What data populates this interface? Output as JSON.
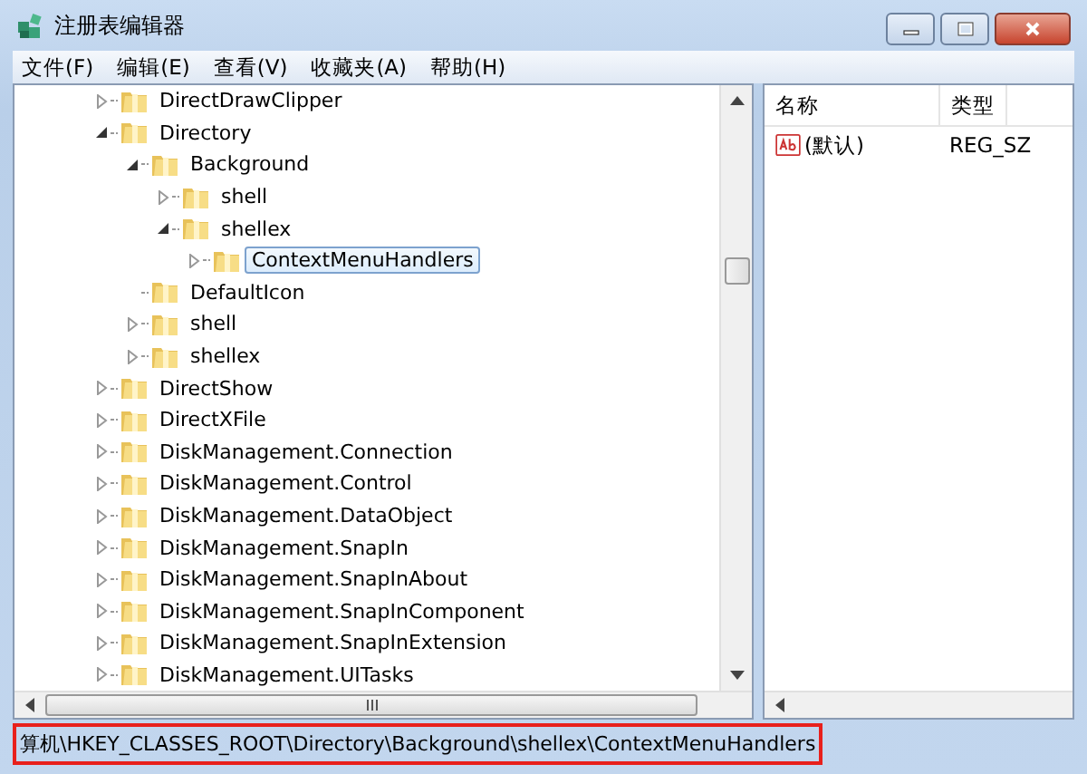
{
  "window": {
    "title": "注册表编辑器"
  },
  "menu": [
    "文件(F)",
    "编辑(E)",
    "查看(V)",
    "收藏夹(A)",
    "帮助(H)"
  ],
  "tree": [
    {
      "label": "DirectDrawClipper",
      "kind": "expandable",
      "expanded": false,
      "selected": false
    },
    {
      "label": "Directory",
      "kind": "expandable",
      "expanded": true,
      "selected": false,
      "children": [
        {
          "label": "Background",
          "kind": "expandable",
          "expanded": true,
          "selected": false,
          "children": [
            {
              "label": "shell",
              "kind": "expandable",
              "expanded": false,
              "selected": false
            },
            {
              "label": "shellex",
              "kind": "expandable",
              "expanded": true,
              "selected": false,
              "children": [
                {
                  "label": "ContextMenuHandlers",
                  "kind": "expandable",
                  "expanded": false,
                  "selected": true
                }
              ]
            }
          ]
        },
        {
          "label": "DefaultIcon",
          "kind": "leaf",
          "selected": false
        },
        {
          "label": "shell",
          "kind": "expandable",
          "expanded": false,
          "selected": false
        },
        {
          "label": "shellex",
          "kind": "expandable",
          "expanded": false,
          "selected": false
        }
      ]
    },
    {
      "label": "DirectShow",
      "kind": "expandable",
      "expanded": false,
      "selected": false
    },
    {
      "label": "DirectXFile",
      "kind": "expandable",
      "expanded": false,
      "selected": false
    },
    {
      "label": "DiskManagement.Connection",
      "kind": "expandable",
      "expanded": false,
      "selected": false
    },
    {
      "label": "DiskManagement.Control",
      "kind": "expandable",
      "expanded": false,
      "selected": false
    },
    {
      "label": "DiskManagement.DataObject",
      "kind": "expandable",
      "expanded": false,
      "selected": false
    },
    {
      "label": "DiskManagement.SnapIn",
      "kind": "expandable",
      "expanded": false,
      "selected": false
    },
    {
      "label": "DiskManagement.SnapInAbout",
      "kind": "expandable",
      "expanded": false,
      "selected": false
    },
    {
      "label": "DiskManagement.SnapInComponent",
      "kind": "expandable",
      "expanded": false,
      "selected": false
    },
    {
      "label": "DiskManagement.SnapInExtension",
      "kind": "expandable",
      "expanded": false,
      "selected": false
    },
    {
      "label": "DiskManagement.UITasks",
      "kind": "expandable",
      "expanded": false,
      "selected": false
    }
  ],
  "values": {
    "columns": [
      "名称",
      "类型"
    ],
    "rows": [
      {
        "name": "(默认)",
        "type": "REG_SZ"
      }
    ]
  },
  "status_bar": "算机\\HKEY_CLASSES_ROOT\\Directory\\Background\\shellex\\ContextMenuHandlers"
}
